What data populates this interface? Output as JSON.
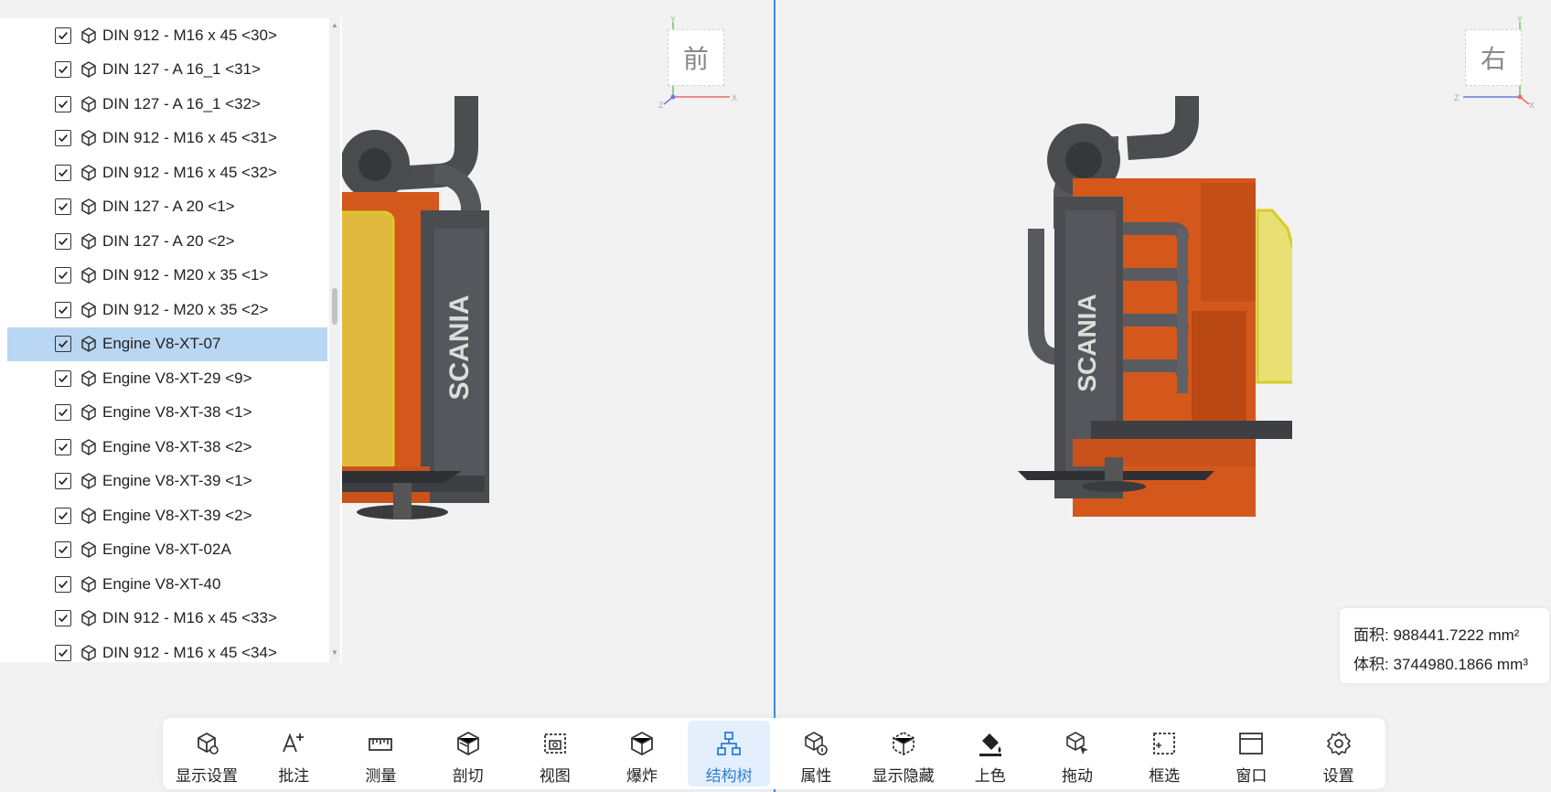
{
  "tree": {
    "items": [
      {
        "label": "DIN 912 - M16 x 45 <30>",
        "checked": true
      },
      {
        "label": "DIN 127 - A 16_1 <31>",
        "checked": true
      },
      {
        "label": "DIN 127 - A 16_1 <32>",
        "checked": true
      },
      {
        "label": "DIN 912 - M16 x 45 <31>",
        "checked": true
      },
      {
        "label": "DIN 912 - M16 x 45 <32>",
        "checked": true
      },
      {
        "label": "DIN 127 - A 20 <1>",
        "checked": true
      },
      {
        "label": "DIN 127 - A 20 <2>",
        "checked": true
      },
      {
        "label": "DIN 912 - M20 x 35 <1>",
        "checked": true
      },
      {
        "label": "DIN 912 - M20 x 35 <2>",
        "checked": true
      },
      {
        "label": "Engine V8-XT-07",
        "checked": true,
        "selected": true
      },
      {
        "label": "Engine V8-XT-29 <9>",
        "checked": true
      },
      {
        "label": "Engine V8-XT-38 <1>",
        "checked": true
      },
      {
        "label": "Engine V8-XT-38 <2>",
        "checked": true
      },
      {
        "label": "Engine V8-XT-39 <1>",
        "checked": true
      },
      {
        "label": "Engine V8-XT-39 <2>",
        "checked": true
      },
      {
        "label": "Engine V8-XT-02A",
        "checked": true
      },
      {
        "label": "Engine V8-XT-40",
        "checked": true
      },
      {
        "label": "DIN 912 - M16 x 45 <33>",
        "checked": true
      },
      {
        "label": "DIN 912 - M16 x 45 <34>",
        "checked": true
      }
    ]
  },
  "viewports": {
    "left": {
      "view_label": "前",
      "axes": {
        "y": "Y",
        "x": "X",
        "z": "Z"
      },
      "brand": "SCANIA"
    },
    "right": {
      "view_label": "右",
      "axes": {
        "y": "Y",
        "x": "X",
        "z": "Z"
      },
      "brand": "SCANIA"
    }
  },
  "measure": {
    "area_label": "面积:",
    "area_value": "988441.7222 mm²",
    "volume_label": "体积:",
    "volume_value": "3744980.1866 mm³"
  },
  "toolbar": {
    "items": [
      {
        "label": "显示设置",
        "icon": "display-settings-icon"
      },
      {
        "label": "批注",
        "icon": "annotation-icon"
      },
      {
        "label": "测量",
        "icon": "ruler-icon"
      },
      {
        "label": "剖切",
        "icon": "section-cut-icon"
      },
      {
        "label": "视图",
        "icon": "view-camera-icon"
      },
      {
        "label": "爆炸",
        "icon": "explode-icon"
      },
      {
        "label": "结构树",
        "icon": "structure-tree-icon",
        "active": true
      },
      {
        "label": "属性",
        "icon": "properties-icon"
      },
      {
        "label": "显示隐藏",
        "icon": "show-hide-icon"
      },
      {
        "label": "上色",
        "icon": "paint-bucket-icon"
      },
      {
        "label": "拖动",
        "icon": "drag-icon"
      },
      {
        "label": "框选",
        "icon": "box-select-icon"
      },
      {
        "label": "窗口",
        "icon": "window-icon"
      },
      {
        "label": "设置",
        "icon": "settings-gear-icon"
      }
    ]
  },
  "colors": {
    "engine_orange": "#d4581c",
    "engine_grey": "#4a4c50",
    "selection_yellow": "#e6d94a",
    "active_blue": "#2f7fd6",
    "selected_row": "#b9d6f3",
    "divider_blue": "#3b8de0"
  }
}
